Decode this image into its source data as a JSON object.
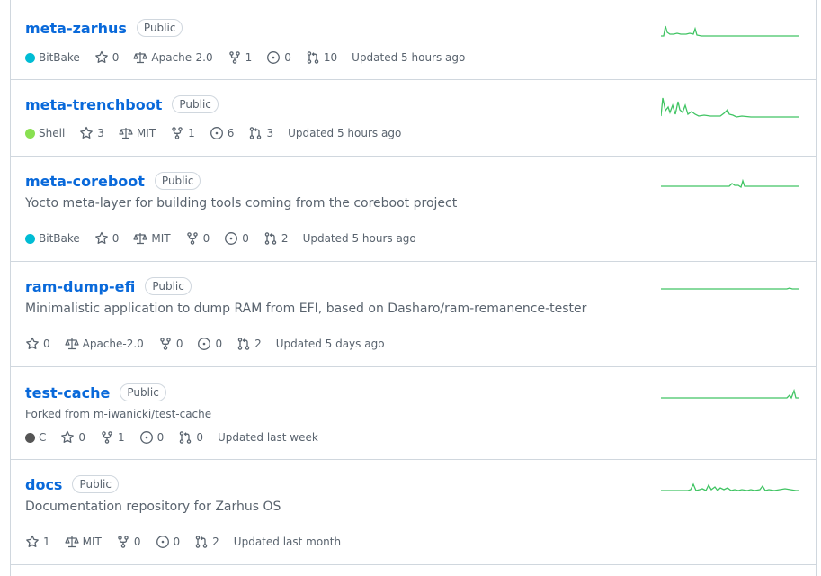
{
  "repos": [
    {
      "name": "meta-zarhus",
      "visibility": "Public",
      "description": "",
      "forked_from": "",
      "language": "BitBake",
      "language_color": "#00bcd4",
      "stars": "0",
      "license": "Apache-2.0",
      "forks": "1",
      "issues": "0",
      "pulls": "10",
      "updated": "Updated 5 hours ago"
    },
    {
      "name": "meta-trenchboot",
      "visibility": "Public",
      "description": "",
      "forked_from": "",
      "language": "Shell",
      "language_color": "#89e051",
      "stars": "3",
      "license": "MIT",
      "forks": "1",
      "issues": "6",
      "pulls": "3",
      "updated": "Updated 5 hours ago"
    },
    {
      "name": "meta-coreboot",
      "visibility": "Public",
      "description": "Yocto meta-layer for building tools coming from the coreboot project",
      "forked_from": "",
      "language": "BitBake",
      "language_color": "#00bcd4",
      "stars": "0",
      "license": "MIT",
      "forks": "0",
      "issues": "0",
      "pulls": "2",
      "updated": "Updated 5 hours ago"
    },
    {
      "name": "ram-dump-efi",
      "visibility": "Public",
      "description": "Minimalistic application to dump RAM from EFI, based on Dasharo/ram-remanence-tester",
      "forked_from": "",
      "language": "",
      "language_color": "",
      "stars": "0",
      "license": "Apache-2.0",
      "forks": "0",
      "issues": "0",
      "pulls": "2",
      "updated": "Updated 5 days ago"
    },
    {
      "name": "test-cache",
      "visibility": "Public",
      "description": "",
      "forked_from_prefix": "Forked from",
      "forked_from": "m-iwanicki/test-cache",
      "language": "C",
      "language_color": "#555555",
      "stars": "0",
      "license": "",
      "forks": "1",
      "issues": "0",
      "pulls": "0",
      "updated": "Updated last week"
    },
    {
      "name": "docs",
      "visibility": "Public",
      "description": "Documentation repository for Zarhus OS",
      "forked_from": "",
      "language": "",
      "language_color": "",
      "stars": "1",
      "license": "MIT",
      "forks": "0",
      "issues": "0",
      "pulls": "2",
      "updated": "Updated last month"
    }
  ],
  "sparkline_color": "#40c463"
}
